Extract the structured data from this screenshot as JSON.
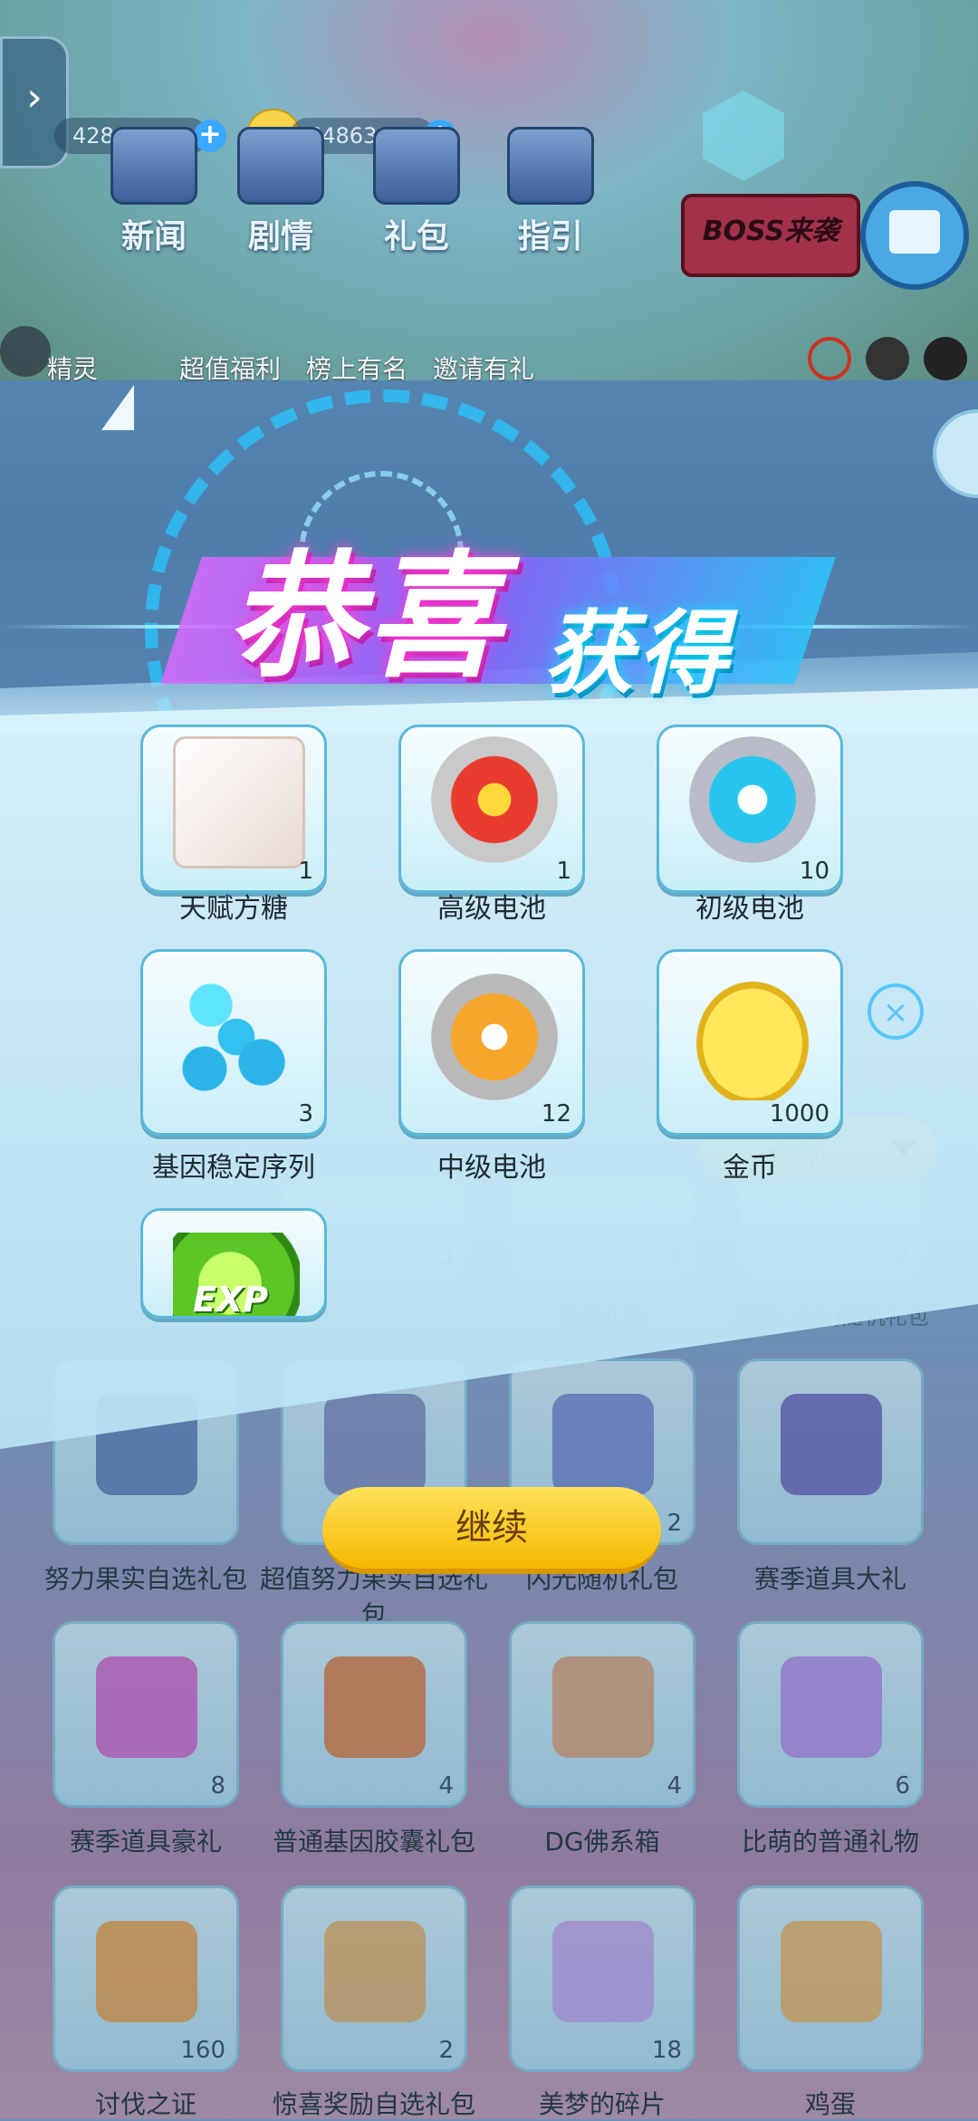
{
  "header": {
    "resource_1": "428",
    "resource_2": "648631",
    "nav": [
      "新闻",
      "剧情",
      "礼包",
      "指引"
    ],
    "boss_label": "BOSS来袭",
    "sub_nav": [
      "精灵",
      "超值福利",
      "榜上有名",
      "邀请有礼"
    ]
  },
  "filter": {
    "label": "全部"
  },
  "background_items": [
    {
      "name": "",
      "count": "3"
    },
    {
      "name": "随机礼包",
      "count": "2"
    },
    {
      "name": "翅膀(30天)随机礼包",
      "count": "2"
    },
    {
      "name": "努力果实自选礼包",
      "count": ""
    },
    {
      "name": "超值努力果实自选礼包",
      "count": ""
    },
    {
      "name": "闪光随机礼包",
      "count": "2"
    },
    {
      "name": "赛季道具大礼",
      "count": ""
    },
    {
      "name": "赛季道具豪礼",
      "count": "8"
    },
    {
      "name": "普通基因胶囊礼包",
      "count": "4"
    },
    {
      "name": "DG佛系箱",
      "count": "4"
    },
    {
      "name": "比萌的普通礼物",
      "count": "6"
    },
    {
      "name": "讨伐之证",
      "count": "160"
    },
    {
      "name": "惊喜奖励自选礼包",
      "count": "2"
    },
    {
      "name": "美梦的碎片",
      "count": "18"
    },
    {
      "name": "鸡蛋",
      "count": ""
    }
  ],
  "reward": {
    "title_part1": "恭喜",
    "title_part2": "获得",
    "items": [
      {
        "name": "天赋方糖",
        "count": "1",
        "icon": "sugar-cube-icon"
      },
      {
        "name": "高级电池",
        "count": "1",
        "icon": "red-battery-icon"
      },
      {
        "name": "初级电池",
        "count": "10",
        "icon": "blue-battery-icon"
      },
      {
        "name": "基因稳定序列",
        "count": "3",
        "icon": "gene-molecule-icon"
      },
      {
        "name": "中级电池",
        "count": "12",
        "icon": "orange-battery-icon"
      },
      {
        "name": "金币",
        "count": "1000",
        "icon": "gold-cat-coin-icon"
      },
      {
        "name": "",
        "count": "",
        "icon": "exp-orb-icon"
      }
    ],
    "continue_label": "继续",
    "exp_text": "EXP"
  }
}
